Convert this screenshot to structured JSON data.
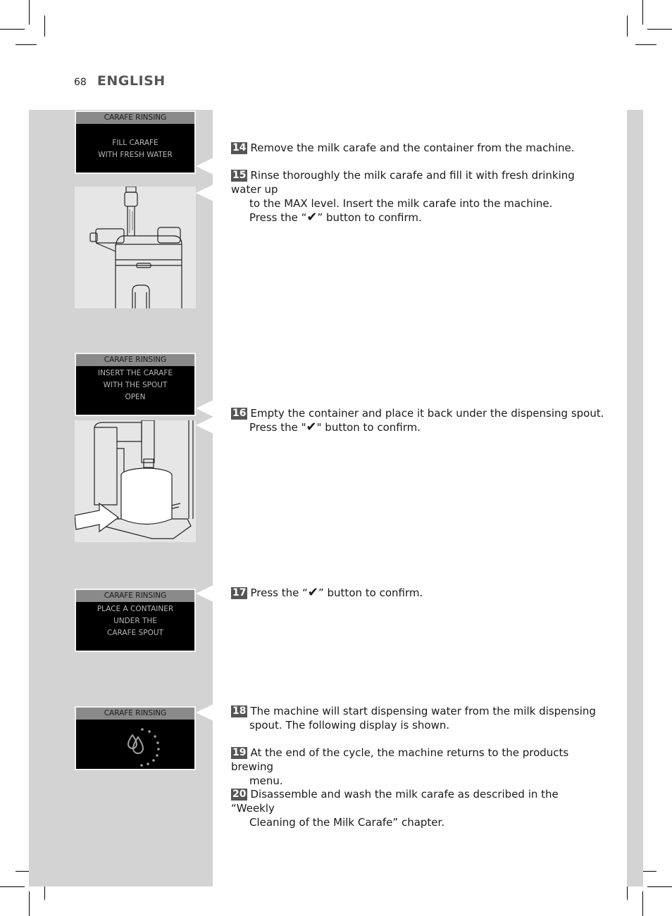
{
  "header": {
    "page_number": "68",
    "language": "ENGLISH"
  },
  "displays": [
    {
      "title": "CARAFE RINSING",
      "lines": [
        "",
        "FILL CARAFE",
        "WITH FRESH WATER"
      ]
    },
    {
      "title": "CARAFE RINSING",
      "lines": [
        "INSERT THE CARAFE",
        "WITH THE SPOUT",
        "OPEN"
      ]
    },
    {
      "title": "CARAFE RINSING",
      "lines": [
        "PLACE A CONTAINER",
        "UNDER THE",
        "CARAFE SPOUT"
      ]
    },
    {
      "title": "CARAFE RINSING",
      "icon": "water-drops-progress-icon"
    }
  ],
  "illustrations": [
    {
      "name": "fill-carafe-under-tap-illustration"
    },
    {
      "name": "place-container-under-spout-illustration"
    }
  ],
  "steps": [
    {
      "number": "14",
      "lines": [
        "Remove the milk carafe and the container from the machine."
      ]
    },
    {
      "number": "15",
      "lines": [
        "Rinse thoroughly the milk carafe and fill it with fresh drinking water up",
        "to the MAX level. Insert the milk carafe into the machine."
      ],
      "confirm": {
        "before": "Press the “",
        "icon": "✔",
        "after": "” button to confirm."
      }
    },
    {
      "number": "16",
      "lines": [
        "Empty the container and place it back under the dispensing spout."
      ],
      "confirm": {
        "before": "Press the \"",
        "icon": "✔",
        "after": "\" button to confirm."
      }
    },
    {
      "number": "17",
      "lines": [],
      "confirm": {
        "before": "Press the “",
        "icon": "✔",
        "after": "” button to confirm."
      }
    },
    {
      "number": "18",
      "lines": [
        "The machine will start dispensing water from the milk dispensing",
        "spout. The following display is shown."
      ]
    },
    {
      "number": "19",
      "lines": [
        "At the end of the cycle, the machine returns to the products brewing",
        "menu."
      ]
    },
    {
      "number": "20",
      "lines": [
        "Disassemble and wash the milk carafe as described in the “Weekly",
        "Cleaning of the Milk Carafe” chapter."
      ]
    }
  ],
  "colors": {
    "panel_gray": "#d3d3d3",
    "step_badge": "#555555",
    "display_bg": "#000000",
    "display_title_bg": "#8a8a8a"
  }
}
